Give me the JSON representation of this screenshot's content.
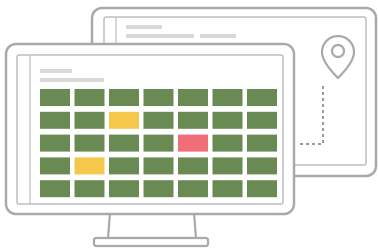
{
  "colors": {
    "outline": "#a9a9a9",
    "frame_fill": "#ffffff",
    "screen_line": "#bdbdbd",
    "text_placeholder": "#d9d9d9",
    "cell_default": "#6a8a53",
    "cell_yellow": "#f5c84c",
    "cell_red": "#f06e78",
    "route": "#9a9a9a"
  },
  "back_monitor": {
    "header_lines": 3,
    "map_pin_icon": "map-pin-icon"
  },
  "front_monitor": {
    "header_lines": 2,
    "grid": {
      "rows": 5,
      "cols": 7,
      "highlights": [
        {
          "row": 1,
          "col": 2,
          "status": "yellow"
        },
        {
          "row": 2,
          "col": 4,
          "status": "red"
        },
        {
          "row": 3,
          "col": 1,
          "status": "yellow"
        }
      ]
    }
  }
}
